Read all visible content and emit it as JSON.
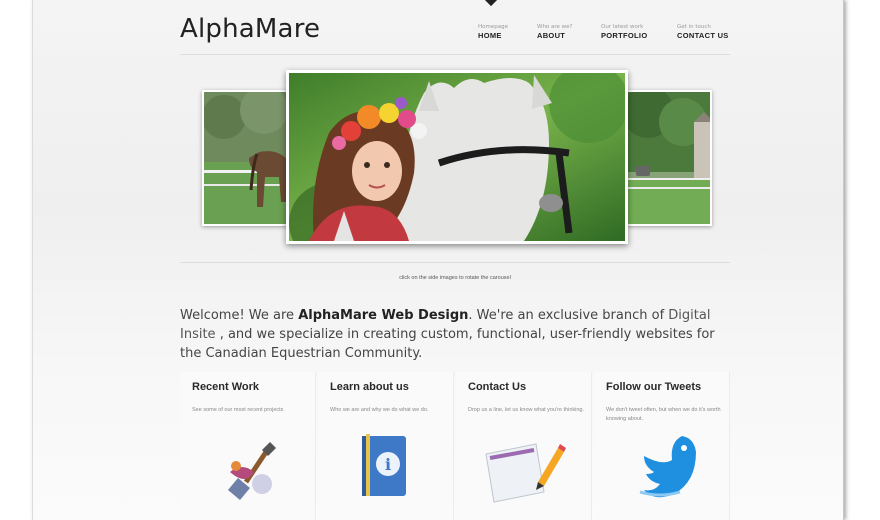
{
  "site": {
    "logo": "AlphaMare"
  },
  "nav": [
    {
      "sub": "Homepage",
      "label": "HOME"
    },
    {
      "sub": "Who are we?",
      "label": "ABOUT"
    },
    {
      "sub": "Our latest work",
      "label": "PORTFOLIO"
    },
    {
      "sub": "Get in touch",
      "label": "CONTACT US"
    }
  ],
  "carousel": {
    "caption": "click on the side images to rotate the carousel"
  },
  "welcome": {
    "part1": "Welcome! We are ",
    "bold": "AlphaMare Web Design",
    "part2": ". We're an exclusive branch of ",
    "link": "Digital Insite",
    "part3": " , and we specialize in creating custom, functional, user-friendly websites for the Canadian Equestrian Community."
  },
  "columns": [
    {
      "title": "Recent Work",
      "desc": "See some of our most recent projects"
    },
    {
      "title": "Learn about us",
      "desc": "Who we are and why we do what we do."
    },
    {
      "title": "Contact Us",
      "desc": "Drop us a line, let us know what you're thinking."
    },
    {
      "title": "Follow our Tweets",
      "desc": "We don't tweet often, but when we do it's worth knowing about."
    }
  ],
  "colors": {
    "accent": "#1f8fe0",
    "text": "#333333",
    "background": "#f2f2f2"
  },
  "icons": [
    "paint-brush-icon",
    "info-book-icon",
    "envelope-pencil-icon",
    "twitter-bird-icon"
  ]
}
